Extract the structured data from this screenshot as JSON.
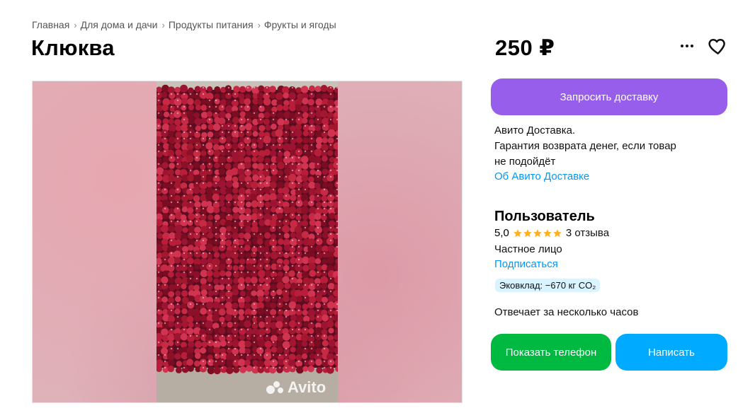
{
  "breadcrumb": [
    "Главная",
    "Для дома и дачи",
    "Продукты питания",
    "Фрукты и ягоды"
  ],
  "listing": {
    "title": "Клюква",
    "price": "250 ₽"
  },
  "gallery": {
    "watermark": "Avito"
  },
  "delivery": {
    "button_label": "Запросить доставку",
    "line1": "Авито Доставка.",
    "line2": "Гарантия возврата денег, если товар",
    "line3": "не подойдёт",
    "about_link": "Об Авито Доставке"
  },
  "seller": {
    "name": "Пользователь",
    "rating": "5,0",
    "stars": 5,
    "reviews": "3 отзыва",
    "type": "Частное лицо",
    "subscribe_link": "Подписаться",
    "eco": "Эковклад: −670 кг CO₂",
    "response_time": "Отвечает за несколько часов"
  },
  "actions": {
    "show_phone": "Показать телефон",
    "write": "Написать"
  },
  "colors": {
    "delivery_button": "#965eeb",
    "phone_button": "#00b940",
    "message_button": "#00aaff",
    "link": "#0099f7",
    "star": "#ffb021"
  }
}
